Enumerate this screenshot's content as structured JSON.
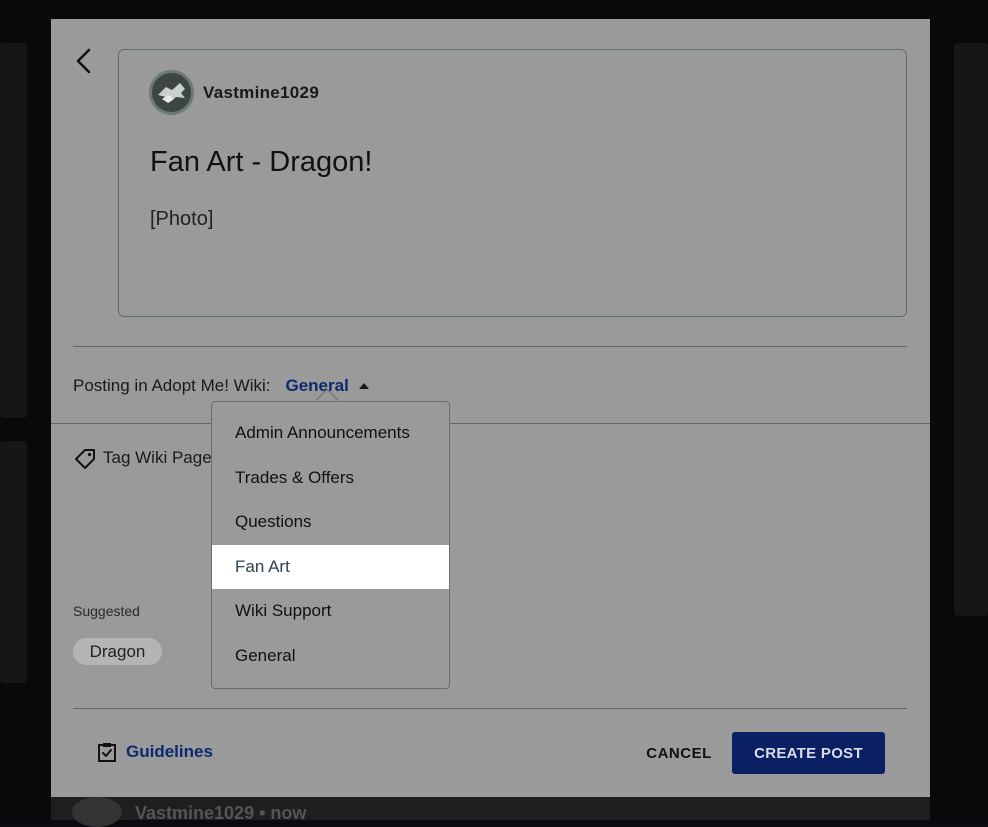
{
  "post": {
    "username": "Vastmine1029",
    "title": "Fan Art - Dragon!",
    "body": "[Photo]"
  },
  "posting": {
    "prefix": "Posting in Adopt Me! Wiki:",
    "selected_category": "General"
  },
  "categories": [
    {
      "label": "Admin Announcements",
      "active": false
    },
    {
      "label": "Trades & Offers",
      "active": false
    },
    {
      "label": "Questions",
      "active": false
    },
    {
      "label": "Fan Art",
      "active": true
    },
    {
      "label": "Wiki Support",
      "active": false
    },
    {
      "label": "General",
      "active": false
    }
  ],
  "tag": {
    "label": "Tag Wiki Page"
  },
  "suggested": {
    "label": "Suggested",
    "chips": [
      "Dragon"
    ]
  },
  "footer": {
    "guidelines_label": "Guidelines",
    "cancel_label": "CANCEL",
    "create_label": "CREATE POST"
  },
  "background": {
    "feed_item_author": "Vastmine1029 • now"
  },
  "colors": {
    "accent": "#0b1f63",
    "link": "#0d2a6e",
    "highlight": "#ffffff"
  }
}
